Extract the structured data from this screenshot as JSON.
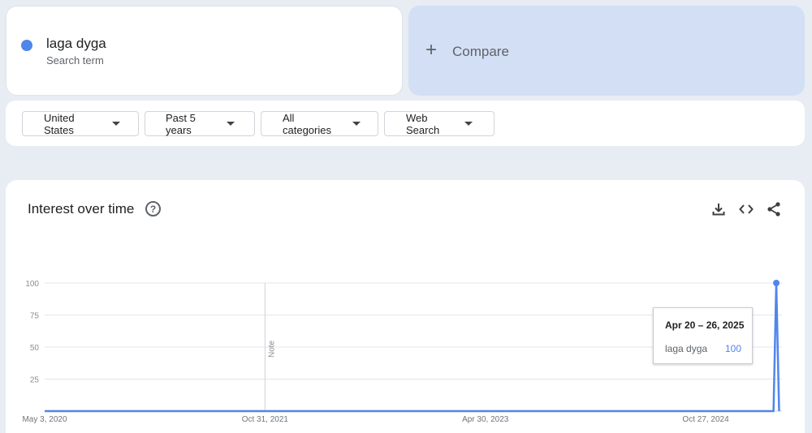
{
  "search": {
    "term": "laga dyga",
    "term_sub": "Search term",
    "term_color": "#4f86ec",
    "compare_label": "Compare",
    "compare_icon": "plus-icon"
  },
  "filters": [
    {
      "label": "United States"
    },
    {
      "label": "Past 5 years"
    },
    {
      "label": "All categories"
    },
    {
      "label": "Web Search"
    }
  ],
  "chart_header": {
    "title": "Interest over time",
    "help_icon": "help-circle-icon",
    "tools": [
      "download-icon",
      "embed-code-icon",
      "share-icon"
    ]
  },
  "tooltip": {
    "date": "Apr 20 – 26, 2025",
    "term": "laga dyga",
    "value": "100"
  },
  "chart_data": {
    "type": "line",
    "title": "Interest over time",
    "xlabel": "",
    "ylabel": "",
    "ylim": [
      0,
      100
    ],
    "y_ticks": [
      "100",
      "75",
      "50",
      "25"
    ],
    "x_tick_labels": [
      "May 3, 2020",
      "Oct 31, 2021",
      "Apr 30, 2023",
      "Oct 27, 2024"
    ],
    "annotation": "Note",
    "grid": true,
    "series": [
      {
        "name": "laga dyga",
        "color": "#4f86ec",
        "points": [
          {
            "x": "2020-05-03",
            "y": 0
          },
          {
            "x": "2025-04-13",
            "y": 0
          },
          {
            "x": "2025-04-20",
            "y": 100
          },
          {
            "x": "2025-04-27",
            "y": 0
          }
        ]
      }
    ]
  }
}
